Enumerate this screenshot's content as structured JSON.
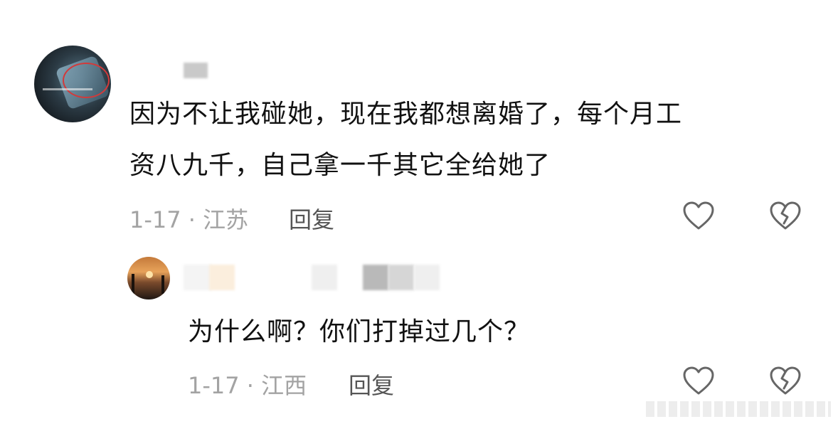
{
  "comment": {
    "text_line1": "因为不让我碰她，现在我都想离婚了，每个月工",
    "text_line2": "资八九千，自己拿一千其它全给她了",
    "date_location": "1-17 · 江苏",
    "reply_label": "回复",
    "like_icon": "heart-icon",
    "dislike_icon": "broken-heart-icon"
  },
  "reply": {
    "text": "为什么啊？你们打掉过几个？",
    "date_location": "1-17 · 江西",
    "reply_label": "回复",
    "like_icon": "heart-icon",
    "dislike_icon": "broken-heart-icon"
  },
  "colors": {
    "text": "#111111",
    "meta": "#a3a3a3",
    "icon": "#666666"
  }
}
